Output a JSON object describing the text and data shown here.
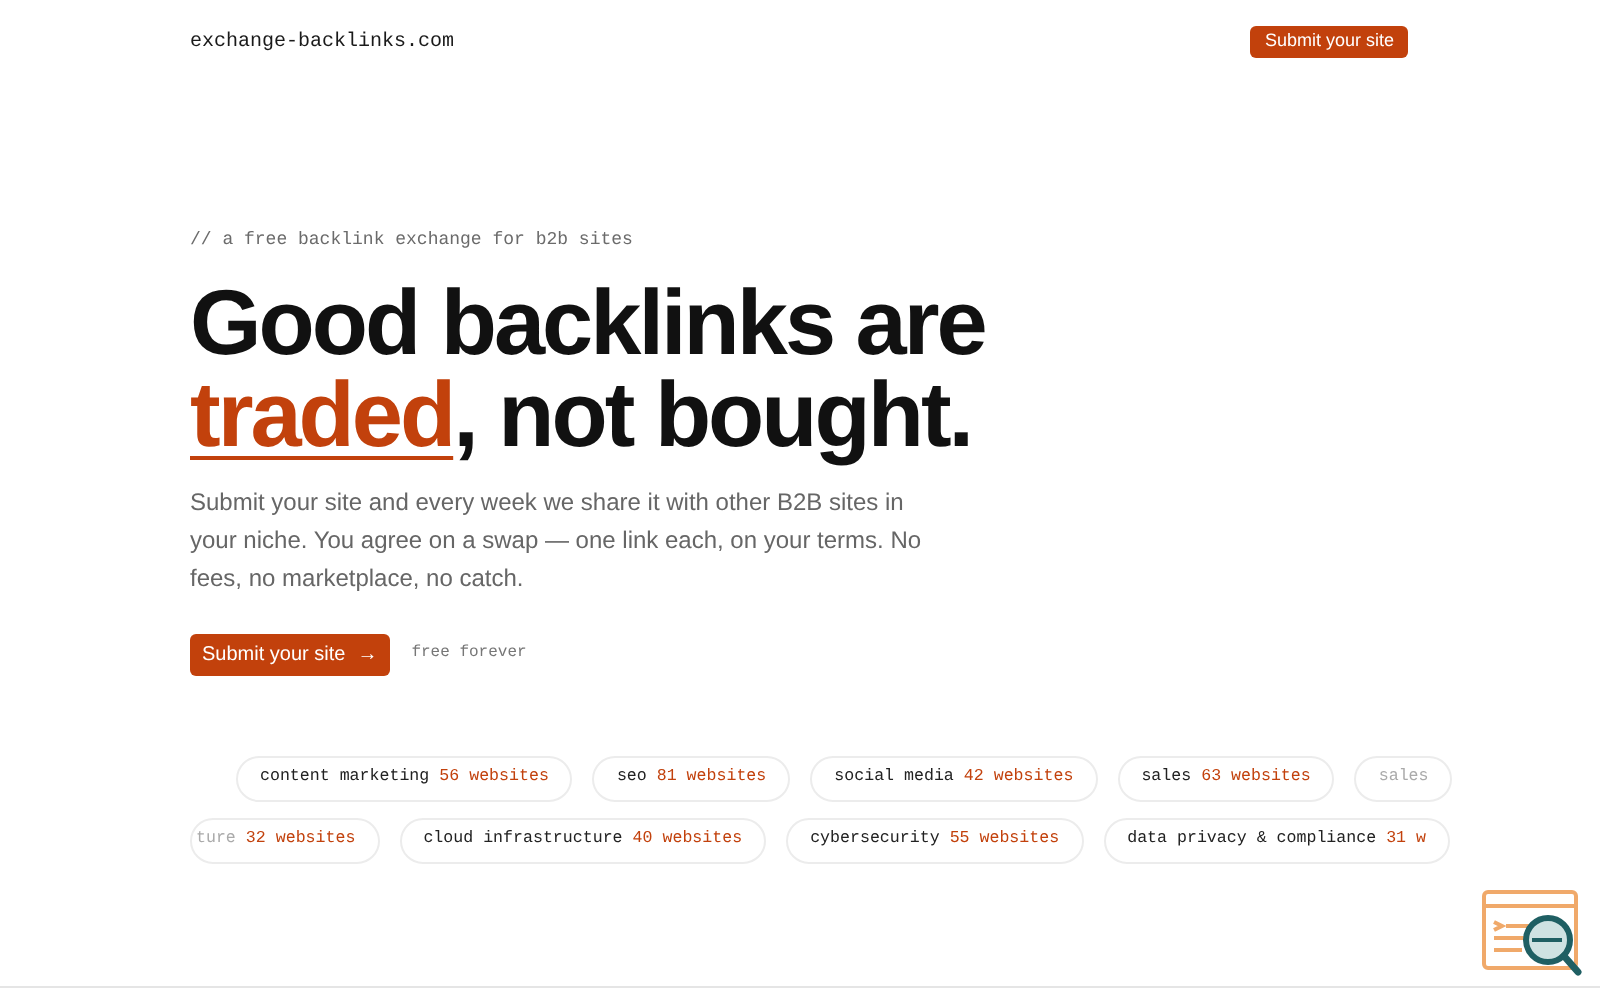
{
  "header": {
    "logo": "exchange-backlinks.com",
    "button": "Submit your site"
  },
  "hero": {
    "eyebrow": "// a free backlink exchange for b2b sites",
    "title_line1": "Good backlinks are",
    "title_highlight": "traded",
    "title_rest": ", not bought.",
    "description": "Submit your site and every week we share it with other B2B sites in your niche. You agree on a swap — one link each, on your terms. No fees, no marketplace, no catch.",
    "cta": "Submit your site",
    "cta_icon": "→",
    "note": "free forever"
  },
  "niche_rows": [
    [
      {
        "name": "content marketing",
        "count": "56 websites"
      },
      {
        "name": "seo",
        "count": "81 websites"
      },
      {
        "name": "social media",
        "count": "42 websites"
      },
      {
        "name": "sales",
        "count": "63 websites"
      },
      {
        "name": "sales"
      }
    ],
    [
      {
        "name": "ture",
        "count": "32 websites"
      },
      {
        "name": "cloud infrastructure",
        "count": "40 websites"
      },
      {
        "name": "cybersecurity",
        "count": "55 websites"
      },
      {
        "name": "data privacy & compliance",
        "count": "31 w"
      }
    ]
  ]
}
